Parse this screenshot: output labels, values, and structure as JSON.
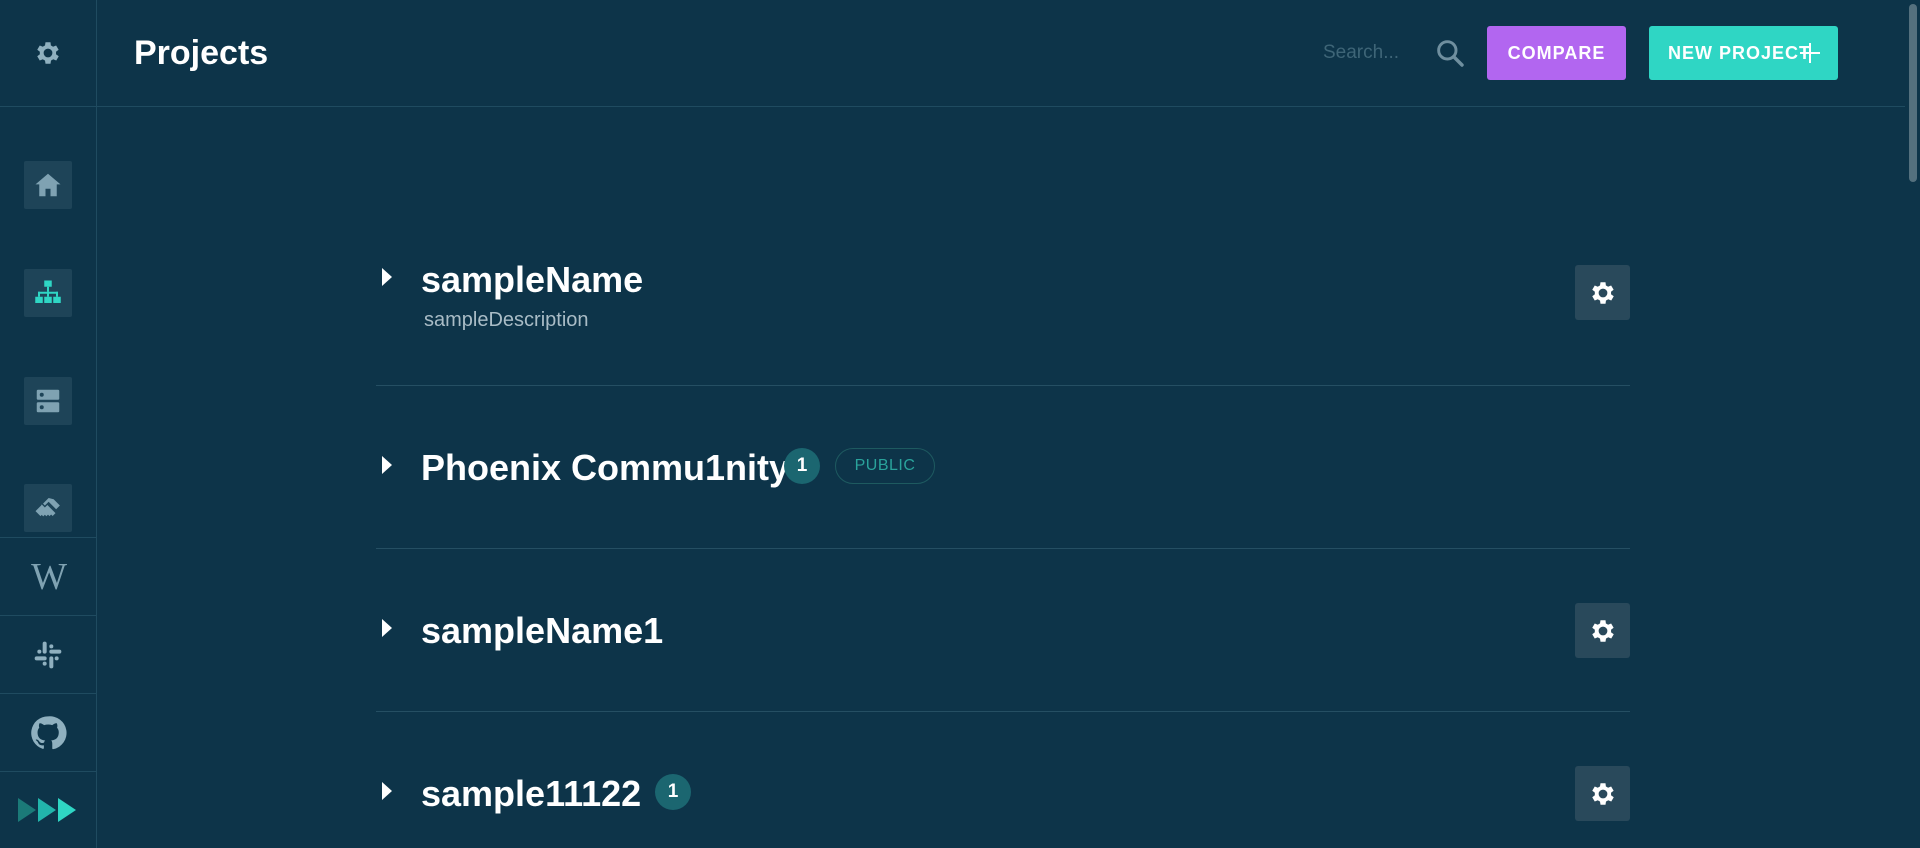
{
  "header": {
    "title": "Projects",
    "search_placeholder": "Search...",
    "compare_label": "COMPARE",
    "new_project_label": "NEW PROJECT"
  },
  "sidebar": {
    "top_icon": "gear-icon",
    "nav_items": [
      {
        "icon": "home-icon"
      },
      {
        "icon": "hierarchy-icon",
        "active": true
      },
      {
        "icon": "server-icon"
      },
      {
        "icon": "handshake-icon"
      }
    ],
    "links": [
      {
        "icon": "wikipedia-icon",
        "label": "W"
      },
      {
        "icon": "slack-icon"
      },
      {
        "icon": "github-icon"
      },
      {
        "icon": "forward-icon"
      }
    ]
  },
  "projects": [
    {
      "name": "sampleName",
      "description": "sampleDescription",
      "has_settings": true
    },
    {
      "name": "Phoenix Commu1nity",
      "count": "1",
      "visibility": "PUBLIC",
      "has_settings": false
    },
    {
      "name": "sampleName1",
      "has_settings": true
    },
    {
      "name": "sample11122",
      "count": "1",
      "has_settings": true
    }
  ],
  "colors": {
    "background": "#0d3449",
    "compare": "#b266f0",
    "new_project": "#2fd6c4",
    "nav_button": "#1e4458",
    "settings_button": "#29495b",
    "count_badge": "#1b6670",
    "public_text": "#2aa39b"
  }
}
